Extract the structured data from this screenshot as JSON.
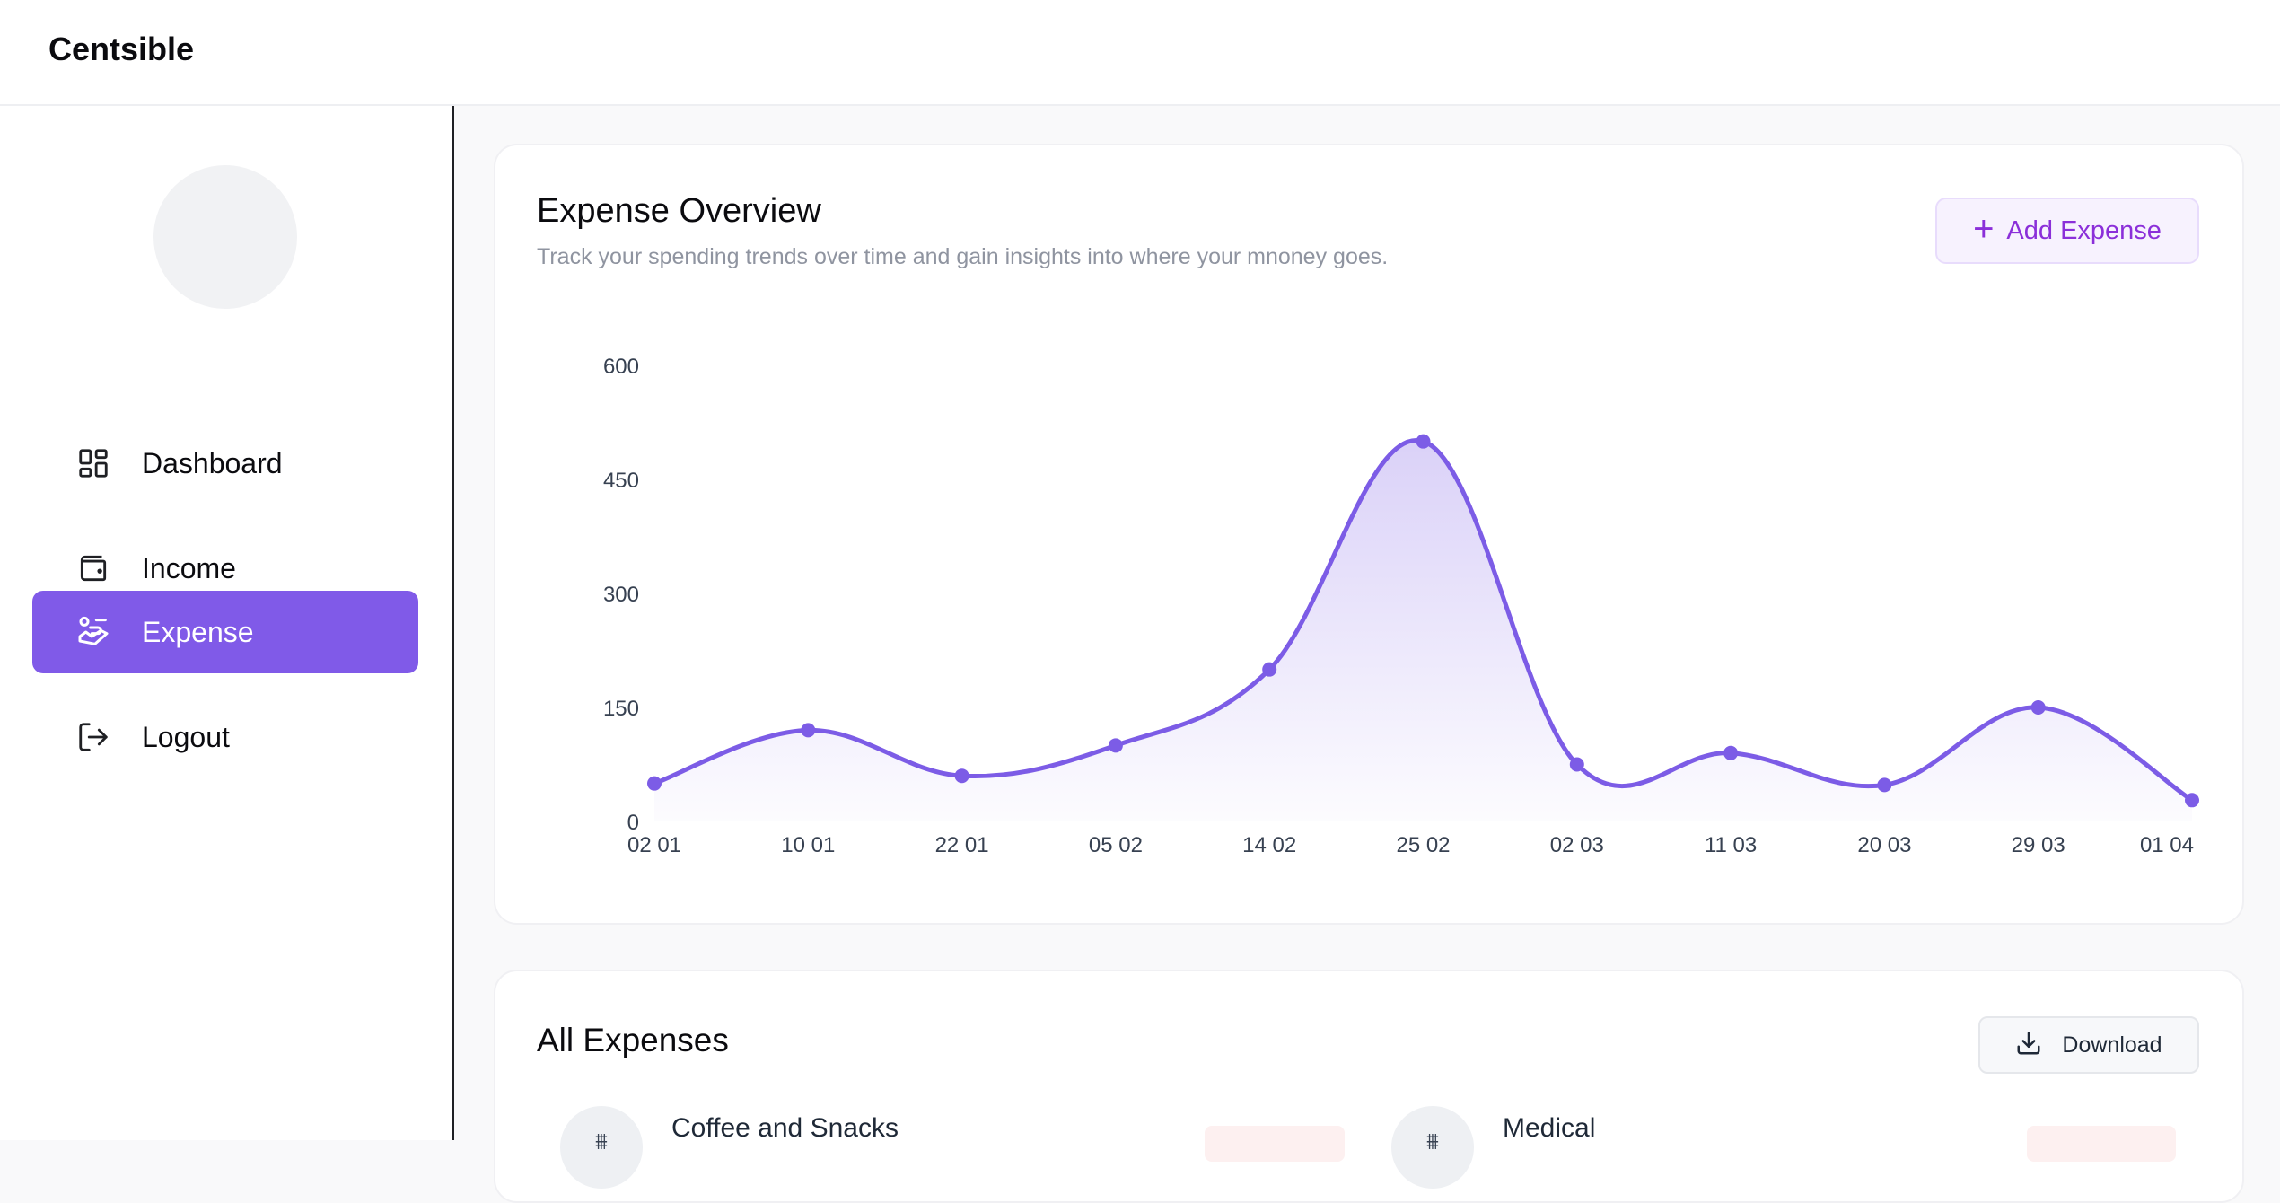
{
  "app": {
    "brand": "Centsible"
  },
  "sidebar": {
    "items": [
      {
        "label": "Dashboard",
        "icon": "dashboard-grid-icon",
        "active": false
      },
      {
        "label": "Income",
        "icon": "wallet-icon",
        "active": false
      },
      {
        "label": "Expense",
        "icon": "hand-coins-icon",
        "active": true
      },
      {
        "label": "Logout",
        "icon": "logout-icon",
        "active": false
      }
    ]
  },
  "overview": {
    "title": "Expense Overview",
    "subtitle": "Track your spending trends over time and gain insights into where your mnoney goes.",
    "add_button": "Add Expense"
  },
  "expenses": {
    "title": "All Expenses",
    "download_button": "Download",
    "items": [
      {
        "name": "Coffee and Snacks"
      },
      {
        "name": "Medical"
      }
    ]
  },
  "colors": {
    "accent": "#805ae8",
    "accent_text": "#8b2fd9",
    "line": "#7c5ce6"
  },
  "chart_data": {
    "type": "area",
    "categories": [
      "02 01",
      "10 01",
      "22 01",
      "05 02",
      "14 02",
      "25 02",
      "02 03",
      "11 03",
      "20 03",
      "29 03",
      "01 04"
    ],
    "values": [
      50,
      120,
      60,
      100,
      200,
      500,
      75,
      90,
      48,
      150,
      28
    ],
    "ylim": [
      0,
      600
    ],
    "yticks": [
      "600",
      "450",
      "300",
      "150",
      "0"
    ],
    "ytick_values": [
      600,
      450,
      300,
      150,
      0
    ],
    "grid": false,
    "smooth": true
  }
}
